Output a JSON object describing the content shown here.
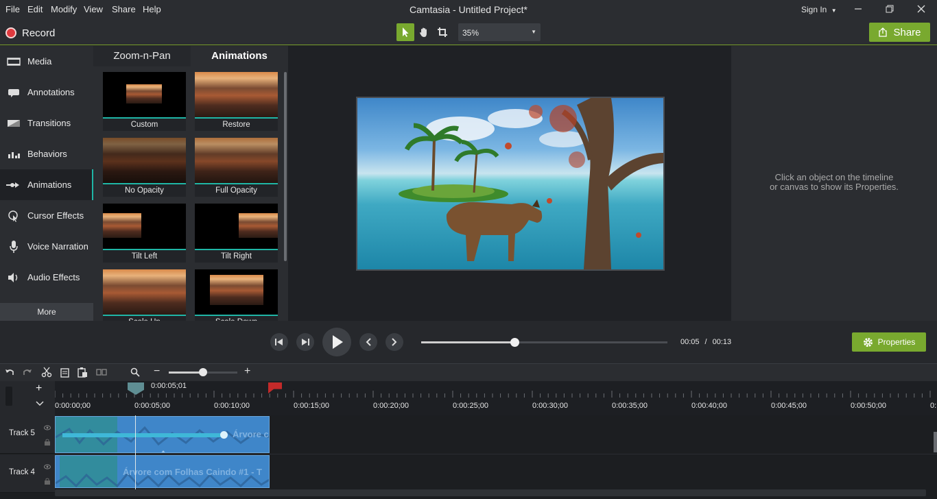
{
  "menubar": {
    "items": [
      "File",
      "Edit",
      "Modify",
      "View",
      "Share",
      "Help"
    ]
  },
  "window": {
    "title": "Camtasia - Untitled Project*",
    "sign_in": "Sign In"
  },
  "toolbar": {
    "record_label": "Record",
    "zoom_value": "35%",
    "share_label": "Share"
  },
  "sidebar": {
    "items": [
      {
        "label": "Media",
        "icon": "film-icon"
      },
      {
        "label": "Annotations",
        "icon": "annotation-icon"
      },
      {
        "label": "Transitions",
        "icon": "transition-icon"
      },
      {
        "label": "Behaviors",
        "icon": "behaviors-icon"
      },
      {
        "label": "Animations",
        "icon": "animation-arrow-icon",
        "active": true
      },
      {
        "label": "Cursor Effects",
        "icon": "cursor-icon"
      },
      {
        "label": "Voice Narration",
        "icon": "microphone-icon"
      },
      {
        "label": "Audio Effects",
        "icon": "speaker-icon"
      }
    ],
    "more_label": "More"
  },
  "library": {
    "tabs": [
      {
        "label": "Zoom-n-Pan"
      },
      {
        "label": "Animations",
        "active": true
      }
    ],
    "tiles": [
      "Custom",
      "Restore",
      "No Opacity",
      "Full Opacity",
      "Tilt Left",
      "Tilt Right",
      "Scale Up",
      "Scale Down"
    ]
  },
  "properties": {
    "hint_line1": "Click an object on the timeline",
    "hint_line2": "or canvas to show its Properties.",
    "button_label": "Properties"
  },
  "playback": {
    "current_time": "00:05",
    "separator": "/",
    "total_time": "00:13",
    "progress": 0.38
  },
  "timeline": {
    "playhead_time": "0:00:05;01",
    "ruler_labels": [
      "0:00:00;00",
      "0:00:05;00",
      "0:00:10;00",
      "0:00:15;00",
      "0:00:20;00",
      "0:00:25;00",
      "0:00:30;00",
      "0:00:35;00",
      "0:00:40;00",
      "0:00:45;00",
      "0:00:50;00",
      "0:"
    ],
    "tracks": [
      {
        "name": "Track 5",
        "clip_title": "Árvore c"
      },
      {
        "name": "Track 4",
        "clip_title": "Árvore com Folhas Caindo #1 - T"
      }
    ],
    "zoom_level": 0.5
  },
  "colors": {
    "accent": "#79a92f",
    "teal": "#1fb6a6",
    "record_red": "#e0393e",
    "clip_blue": "#3f86c9"
  }
}
